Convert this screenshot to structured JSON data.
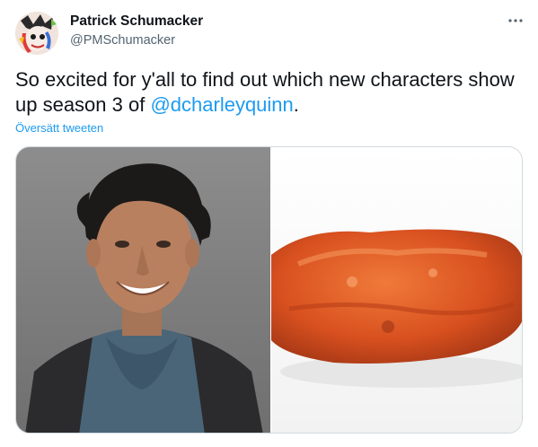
{
  "author": {
    "name": "Patrick Schumacker",
    "handle": "@PMSchumacker"
  },
  "tweet": {
    "text_before": "So excited for y'all to find out which new characters show up season 3 of ",
    "mention": "@dcharleyquinn",
    "text_after": ".",
    "translate_label": "Översätt tweeten"
  },
  "icons": {
    "more": "more-options-icon",
    "avatar": "profile-avatar"
  },
  "media": {
    "left_image": "portrait-photo",
    "right_image": "chicken-wing-photo"
  },
  "colors": {
    "link": "#1d9bf0",
    "text": "#0f1419",
    "secondary": "#536471",
    "border": "#cfd9de"
  }
}
